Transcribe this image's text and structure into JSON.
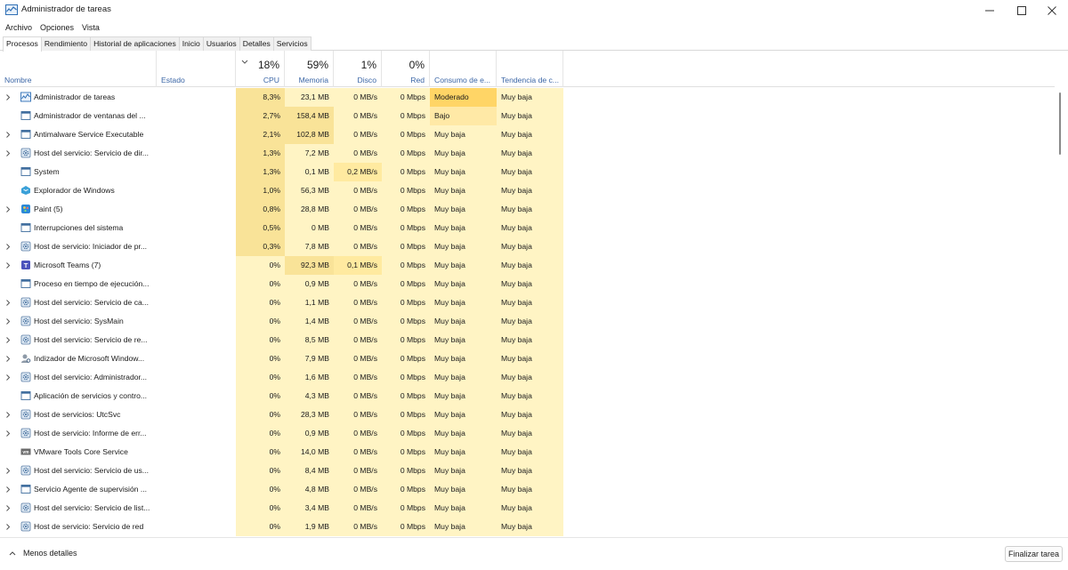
{
  "window": {
    "title": "Administrador de tareas"
  },
  "menu": [
    "Archivo",
    "Opciones",
    "Vista"
  ],
  "tabs": [
    "Procesos",
    "Rendimiento",
    "Historial de aplicaciones",
    "Inicio",
    "Usuarios",
    "Detalles",
    "Servicios"
  ],
  "active_tab": "Procesos",
  "columns": {
    "name": {
      "label": "Nombre"
    },
    "status": {
      "label": "Estado"
    },
    "cpu": {
      "label": "CPU",
      "pct": "18%"
    },
    "memory": {
      "label": "Memoria",
      "pct": "59%"
    },
    "disk": {
      "label": "Disco",
      "pct": "1%"
    },
    "network": {
      "label": "Red",
      "pct": "0%"
    },
    "power": {
      "label": "Consumo de e..."
    },
    "trend": {
      "label": "Tendencia de c..."
    }
  },
  "colors": {
    "heat_light": "#fff4c4",
    "heat_mid": "#ffeaa0",
    "heat_strong": "#f9e398",
    "moderate": "#ffd566",
    "low": "#ffe9a6",
    "header_blue": "#3b66a6"
  },
  "rows": [
    {
      "name": "Administrador de tareas",
      "icon": "task-manager-icon",
      "expand": true,
      "status": "",
      "cpu": "8,3%",
      "mem": "23,1 MB",
      "disk": "0 MB/s",
      "net": "0 Mbps",
      "power": "Moderado",
      "trend": "Muy baja",
      "cpu_level": 2,
      "mem_level": 1,
      "disk_level": 0,
      "power_level": 3
    },
    {
      "name": "Administrador de ventanas del ...",
      "icon": "window-icon",
      "expand": false,
      "status": "",
      "cpu": "2,7%",
      "mem": "158,4 MB",
      "disk": "0 MB/s",
      "net": "0 Mbps",
      "power": "Bajo",
      "trend": "Muy baja",
      "cpu_level": 2,
      "mem_level": 2,
      "disk_level": 0,
      "power_level": 2
    },
    {
      "name": "Antimalware Service Executable",
      "icon": "window-icon",
      "expand": true,
      "status": "",
      "cpu": "2,1%",
      "mem": "102,8 MB",
      "disk": "0 MB/s",
      "net": "0 Mbps",
      "power": "Muy baja",
      "trend": "Muy baja",
      "cpu_level": 2,
      "mem_level": 2,
      "disk_level": 0,
      "power_level": 0
    },
    {
      "name": "Host del servicio: Servicio de dir...",
      "icon": "gear-icon",
      "expand": true,
      "status": "",
      "cpu": "1,3%",
      "mem": "7,2 MB",
      "disk": "0 MB/s",
      "net": "0 Mbps",
      "power": "Muy baja",
      "trend": "Muy baja",
      "cpu_level": 2,
      "mem_level": 1,
      "disk_level": 0,
      "power_level": 0
    },
    {
      "name": "System",
      "icon": "window-icon",
      "expand": false,
      "status": "",
      "cpu": "1,3%",
      "mem": "0,1 MB",
      "disk": "0,2 MB/s",
      "net": "0 Mbps",
      "power": "Muy baja",
      "trend": "Muy baja",
      "cpu_level": 2,
      "mem_level": 1,
      "disk_level": 1,
      "power_level": 0
    },
    {
      "name": "Explorador de Windows",
      "icon": "explorer-icon",
      "expand": false,
      "status": "",
      "cpu": "1,0%",
      "mem": "56,3 MB",
      "disk": "0 MB/s",
      "net": "0 Mbps",
      "power": "Muy baja",
      "trend": "Muy baja",
      "cpu_level": 2,
      "mem_level": 1,
      "disk_level": 0,
      "power_level": 0
    },
    {
      "name": "Paint (5)",
      "icon": "paint-icon",
      "expand": true,
      "status": "",
      "cpu": "0,8%",
      "mem": "28,8 MB",
      "disk": "0 MB/s",
      "net": "0 Mbps",
      "power": "Muy baja",
      "trend": "Muy baja",
      "cpu_level": 2,
      "mem_level": 1,
      "disk_level": 0,
      "power_level": 0
    },
    {
      "name": "Interrupciones del sistema",
      "icon": "window-icon",
      "expand": false,
      "status": "",
      "cpu": "0,5%",
      "mem": "0 MB",
      "disk": "0 MB/s",
      "net": "0 Mbps",
      "power": "Muy baja",
      "trend": "Muy baja",
      "cpu_level": 2,
      "mem_level": 1,
      "disk_level": 0,
      "power_level": 0
    },
    {
      "name": "Host de servicio: Iniciador de pr...",
      "icon": "gear-icon",
      "expand": true,
      "status": "",
      "cpu": "0,3%",
      "mem": "7,8 MB",
      "disk": "0 MB/s",
      "net": "0 Mbps",
      "power": "Muy baja",
      "trend": "Muy baja",
      "cpu_level": 2,
      "mem_level": 1,
      "disk_level": 0,
      "power_level": 0
    },
    {
      "name": "Microsoft Teams (7)",
      "icon": "teams-icon",
      "expand": true,
      "status": "",
      "cpu": "0%",
      "mem": "92,3 MB",
      "disk": "0,1 MB/s",
      "net": "0 Mbps",
      "power": "Muy baja",
      "trend": "Muy baja",
      "cpu_level": 1,
      "mem_level": 2,
      "disk_level": 1,
      "power_level": 0
    },
    {
      "name": "Proceso en tiempo de ejecución...",
      "icon": "window-icon",
      "expand": false,
      "status": "",
      "cpu": "0%",
      "mem": "0,9 MB",
      "disk": "0 MB/s",
      "net": "0 Mbps",
      "power": "Muy baja",
      "trend": "Muy baja",
      "cpu_level": 1,
      "mem_level": 1,
      "disk_level": 0,
      "power_level": 0
    },
    {
      "name": "Host del servicio: Servicio de ca...",
      "icon": "gear-icon",
      "expand": true,
      "status": "",
      "cpu": "0%",
      "mem": "1,1 MB",
      "disk": "0 MB/s",
      "net": "0 Mbps",
      "power": "Muy baja",
      "trend": "Muy baja",
      "cpu_level": 1,
      "mem_level": 1,
      "disk_level": 0,
      "power_level": 0
    },
    {
      "name": "Host del servicio: SysMain",
      "icon": "gear-icon",
      "expand": true,
      "status": "",
      "cpu": "0%",
      "mem": "1,4 MB",
      "disk": "0 MB/s",
      "net": "0 Mbps",
      "power": "Muy baja",
      "trend": "Muy baja",
      "cpu_level": 1,
      "mem_level": 1,
      "disk_level": 0,
      "power_level": 0
    },
    {
      "name": "Host del servicio: Servicio de re...",
      "icon": "gear-icon",
      "expand": true,
      "status": "",
      "cpu": "0%",
      "mem": "8,5 MB",
      "disk": "0 MB/s",
      "net": "0 Mbps",
      "power": "Muy baja",
      "trend": "Muy baja",
      "cpu_level": 1,
      "mem_level": 1,
      "disk_level": 0,
      "power_level": 0
    },
    {
      "name": "Indizador de Microsoft Window...",
      "icon": "indexer-icon",
      "expand": true,
      "status": "",
      "cpu": "0%",
      "mem": "7,9 MB",
      "disk": "0 MB/s",
      "net": "0 Mbps",
      "power": "Muy baja",
      "trend": "Muy baja",
      "cpu_level": 1,
      "mem_level": 1,
      "disk_level": 0,
      "power_level": 0
    },
    {
      "name": "Host del servicio: Administrador...",
      "icon": "gear-icon",
      "expand": true,
      "status": "",
      "cpu": "0%",
      "mem": "1,6 MB",
      "disk": "0 MB/s",
      "net": "0 Mbps",
      "power": "Muy baja",
      "trend": "Muy baja",
      "cpu_level": 1,
      "mem_level": 1,
      "disk_level": 0,
      "power_level": 0
    },
    {
      "name": "Aplicación de servicios y contro...",
      "icon": "window-icon",
      "expand": false,
      "status": "",
      "cpu": "0%",
      "mem": "4,3 MB",
      "disk": "0 MB/s",
      "net": "0 Mbps",
      "power": "Muy baja",
      "trend": "Muy baja",
      "cpu_level": 1,
      "mem_level": 1,
      "disk_level": 0,
      "power_level": 0
    },
    {
      "name": "Host de servicios: UtcSvc",
      "icon": "gear-icon",
      "expand": true,
      "status": "",
      "cpu": "0%",
      "mem": "28,3 MB",
      "disk": "0 MB/s",
      "net": "0 Mbps",
      "power": "Muy baja",
      "trend": "Muy baja",
      "cpu_level": 1,
      "mem_level": 1,
      "disk_level": 0,
      "power_level": 0
    },
    {
      "name": "Host de servicio: Informe de err...",
      "icon": "gear-icon",
      "expand": true,
      "status": "",
      "cpu": "0%",
      "mem": "0,9 MB",
      "disk": "0 MB/s",
      "net": "0 Mbps",
      "power": "Muy baja",
      "trend": "Muy baja",
      "cpu_level": 1,
      "mem_level": 1,
      "disk_level": 0,
      "power_level": 0
    },
    {
      "name": "VMware Tools Core Service",
      "icon": "vmware-icon",
      "expand": false,
      "status": "",
      "cpu": "0%",
      "mem": "14,0 MB",
      "disk": "0 MB/s",
      "net": "0 Mbps",
      "power": "Muy baja",
      "trend": "Muy baja",
      "cpu_level": 1,
      "mem_level": 1,
      "disk_level": 0,
      "power_level": 0
    },
    {
      "name": "Host del servicio: Servicio de us...",
      "icon": "gear-icon",
      "expand": true,
      "status": "",
      "cpu": "0%",
      "mem": "8,4 MB",
      "disk": "0 MB/s",
      "net": "0 Mbps",
      "power": "Muy baja",
      "trend": "Muy baja",
      "cpu_level": 1,
      "mem_level": 1,
      "disk_level": 0,
      "power_level": 0
    },
    {
      "name": "Servicio Agente de supervisión ...",
      "icon": "window-icon",
      "expand": true,
      "status": "",
      "cpu": "0%",
      "mem": "4,8 MB",
      "disk": "0 MB/s",
      "net": "0 Mbps",
      "power": "Muy baja",
      "trend": "Muy baja",
      "cpu_level": 1,
      "mem_level": 1,
      "disk_level": 0,
      "power_level": 0
    },
    {
      "name": "Host del servicio: Servicio de list...",
      "icon": "gear-icon",
      "expand": true,
      "status": "",
      "cpu": "0%",
      "mem": "3,4 MB",
      "disk": "0 MB/s",
      "net": "0 Mbps",
      "power": "Muy baja",
      "trend": "Muy baja",
      "cpu_level": 1,
      "mem_level": 1,
      "disk_level": 0,
      "power_level": 0
    },
    {
      "name": "Host de servicio: Servicio de red",
      "icon": "gear-icon",
      "expand": true,
      "status": "",
      "cpu": "0%",
      "mem": "1,9 MB",
      "disk": "0 MB/s",
      "net": "0 Mbps",
      "power": "Muy baja",
      "trend": "Muy baja",
      "cpu_level": 1,
      "mem_level": 1,
      "disk_level": 0,
      "power_level": 0
    }
  ],
  "footer": {
    "less_details": "Menos detalles",
    "end_task": "Finalizar tarea"
  }
}
